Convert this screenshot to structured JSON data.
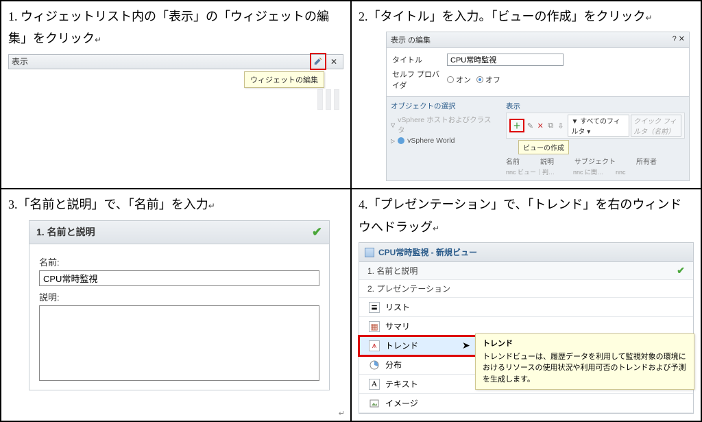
{
  "cell1": {
    "instruction": "1. ウィジェットリスト内の「表示」の「ウィジェットの編集」をクリック",
    "instruction_tail": "↵",
    "widget_title": "表示",
    "edit_icon_name": "pencil-icon",
    "close_icon": "✕",
    "tooltip": "ウィジェットの編集"
  },
  "cell2": {
    "instruction": "2.「タイトル」を入力。「ビューの作成」をクリック",
    "instruction_tail": "↵",
    "dialog_title": "表示 の編集",
    "dialog_help": "?   ✕",
    "label_title": "タイトル",
    "title_value": "CPU常時監視",
    "label_provider": "セルフ プロバイダ",
    "radio_on": "オン",
    "radio_off": "オフ",
    "tree_header": "オブジェクトの選択",
    "tree_node1": "vSphere ホストおよびクラスタ",
    "tree_node2": "vSphere World",
    "display_header": "表示",
    "filter_label": "すべてのフィルタ ▾",
    "search_placeholder": "クイック フィルタ（名前）",
    "create_tooltip": "ビューの作成",
    "col1": "名前",
    "col2": "説明",
    "col3": "サブジェクト",
    "col4": "所有者",
    "sample_row": "nnc ビュー｜判…　　　nnc に関…　　nnc"
  },
  "cell3": {
    "instruction": "3.「名前と説明」で、「名前」を入力",
    "instruction_tail": "↵",
    "header": "1. 名前と説明",
    "label_name": "名前:",
    "name_value": "CPU常時監視",
    "label_desc": "説明:"
  },
  "cell4": {
    "instruction": "4.「プレゼンテーション」で、「トレンド」を右のウィンドウへドラッグ",
    "instruction_tail": "↵",
    "wizard_title": "CPU常時監視 - 新規ビュー",
    "step1": "1. 名前と説明",
    "step2": "2. プレゼンテーション",
    "types": {
      "list": "リスト",
      "summary": "サマリ",
      "trend": "トレンド",
      "distribution": "分布",
      "text": "テキスト",
      "image": "イメージ"
    },
    "tip_title": "トレンド",
    "tip_body": "トレンドビューは、履歴データを利用して監視対象の環境におけるリソースの使用状況や利用可否のトレンドおよび予測を生成します。"
  }
}
